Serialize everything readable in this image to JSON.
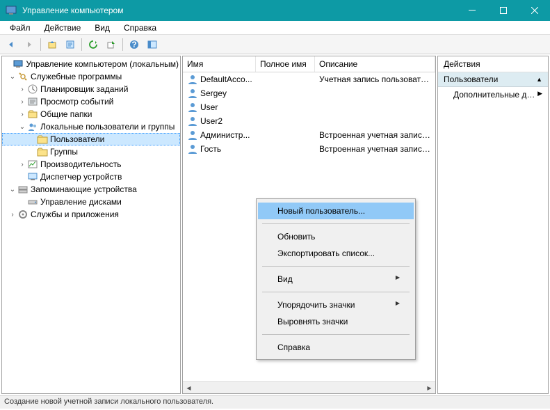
{
  "window": {
    "title": "Управление компьютером"
  },
  "menu": {
    "file": "Файл",
    "action": "Действие",
    "view": "Вид",
    "help": "Справка"
  },
  "tree": {
    "root": "Управление компьютером (локальным)",
    "sys_tools": "Служебные программы",
    "task_sched": "Планировщик заданий",
    "event_viewer": "Просмотр событий",
    "shared_folders": "Общие папки",
    "local_users_groups": "Локальные пользователи и группы",
    "users": "Пользователи",
    "groups": "Группы",
    "performance": "Производительность",
    "device_mgr": "Диспетчер устройств",
    "storage": "Запоминающие устройства",
    "disk_mgmt": "Управление дисками",
    "services_apps": "Службы и приложения"
  },
  "columns": {
    "name": "Имя",
    "fullname": "Полное имя",
    "description": "Описание"
  },
  "users": [
    {
      "name": "DefaultAcco...",
      "fullname": "",
      "description": "Учетная запись пользователя, у..."
    },
    {
      "name": "Sergey",
      "fullname": "",
      "description": ""
    },
    {
      "name": "User",
      "fullname": "",
      "description": ""
    },
    {
      "name": "User2",
      "fullname": "",
      "description": ""
    },
    {
      "name": "Администр...",
      "fullname": "",
      "description": "Встроенная учетная запись адм..."
    },
    {
      "name": "Гость",
      "fullname": "",
      "description": "Встроенная учетная запись для ..."
    }
  ],
  "actions": {
    "header": "Действия",
    "category": "Пользователи",
    "more": "Дополнительные дей..."
  },
  "context_menu": {
    "new_user": "Новый пользователь...",
    "refresh": "Обновить",
    "export": "Экспортировать список...",
    "view": "Вид",
    "arrange_icons": "Упорядочить значки",
    "align_icons": "Выровнять значки",
    "help": "Справка"
  },
  "status": "Создание новой учетной записи локального пользователя."
}
